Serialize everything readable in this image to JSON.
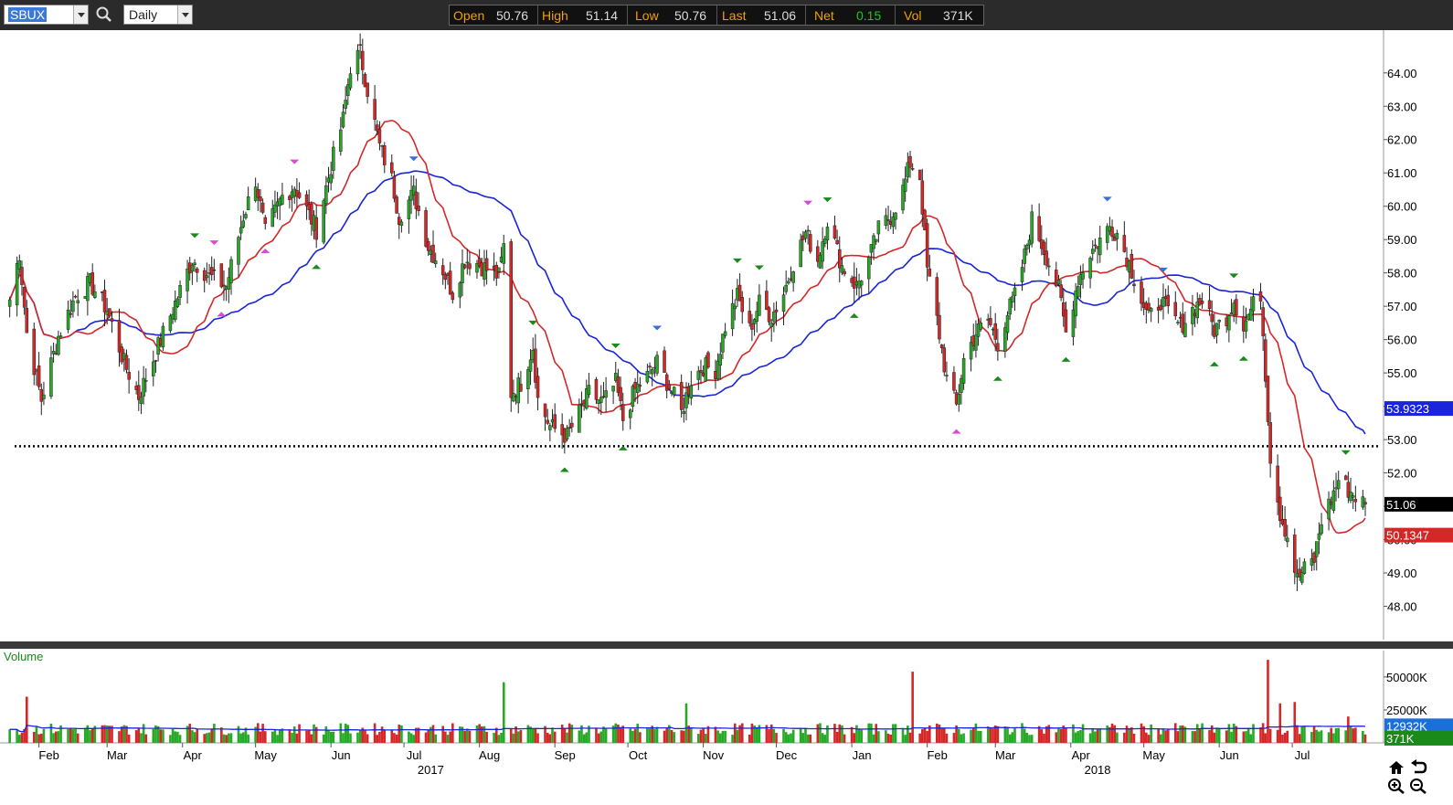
{
  "toolbar": {
    "symbol": "SBUX",
    "interval": "Daily",
    "search_icon": "search-icon",
    "quote": {
      "open_label": "Open",
      "open": "50.76",
      "high_label": "High",
      "high": "51.14",
      "low_label": "Low",
      "low": "50.76",
      "last_label": "Last",
      "last": "51.06",
      "net_label": "Net",
      "net": "0.15",
      "vol_label": "Vol",
      "vol": "371K"
    }
  },
  "colors": {
    "up_candle": "#27a827",
    "down_candle": "#d42828",
    "ma_fast": "#d42828",
    "ma_slow": "#1a24d8",
    "volume_avg": "#1a24d8",
    "marker_green": "#1a8a1a",
    "marker_blue": "#3a6fd8",
    "marker_magenta": "#d84ad8",
    "net_positive": "#22c322"
  },
  "chart_data": [
    {
      "type": "candlestick",
      "symbol": "SBUX",
      "interval": "Daily",
      "ylim": [
        47,
        65.2
      ],
      "price_ticks": [
        "48.00",
        "49.00",
        "50.00",
        "51.00",
        "52.00",
        "53.00",
        "54.00",
        "55.00",
        "56.00",
        "57.00",
        "58.00",
        "59.00",
        "60.00",
        "61.00",
        "62.00",
        "63.00",
        "64.00"
      ],
      "x_months": [
        "Feb",
        "Mar",
        "Apr",
        "May",
        "Jun",
        "Jul",
        "Aug",
        "Sep",
        "Oct",
        "Nov",
        "Dec",
        "Jan",
        "Feb",
        "Mar",
        "Apr",
        "May",
        "Jun",
        "Jul"
      ],
      "x_years": [
        "2017",
        "2018"
      ],
      "price_keypoints": [
        [
          "2017-01-20",
          57.2
        ],
        [
          "2017-01-24",
          58.6
        ],
        [
          "2017-01-27",
          56.2
        ],
        [
          "2017-02-02",
          54.2
        ],
        [
          "2017-02-09",
          56.1
        ],
        [
          "2017-02-16",
          57.3
        ],
        [
          "2017-02-22",
          57.7
        ],
        [
          "2017-03-01",
          56.9
        ],
        [
          "2017-03-08",
          55.3
        ],
        [
          "2017-03-14",
          54.3
        ],
        [
          "2017-03-22",
          55.8
        ],
        [
          "2017-03-29",
          57.1
        ],
        [
          "2017-04-05",
          58.4
        ],
        [
          "2017-04-12",
          57.9
        ],
        [
          "2017-04-19",
          57.6
        ],
        [
          "2017-04-26",
          59.7
        ],
        [
          "2017-05-01",
          60.8
        ],
        [
          "2017-05-05",
          59.2
        ],
        [
          "2017-05-12",
          60.3
        ],
        [
          "2017-05-17",
          60.6
        ],
        [
          "2017-05-22",
          59.9
        ],
        [
          "2017-05-26",
          59.3
        ],
        [
          "2017-06-01",
          61.2
        ],
        [
          "2017-06-06",
          62.6
        ],
        [
          "2017-06-09",
          64.2
        ],
        [
          "2017-06-13",
          64.6
        ],
        [
          "2017-06-16",
          63.5
        ],
        [
          "2017-06-21",
          61.8
        ],
        [
          "2017-06-26",
          60.8
        ],
        [
          "2017-06-29",
          59.7
        ],
        [
          "2017-07-05",
          60.4
        ],
        [
          "2017-07-11",
          58.8
        ],
        [
          "2017-07-17",
          58.1
        ],
        [
          "2017-07-21",
          57.4
        ],
        [
          "2017-07-26",
          58.4
        ],
        [
          "2017-07-31",
          58.3
        ],
        [
          "2017-08-04",
          58.1
        ],
        [
          "2017-08-09",
          57.9
        ],
        [
          "2017-08-11",
          58.8
        ],
        [
          "2017-08-14",
          54.4
        ],
        [
          "2017-08-18",
          54.7
        ],
        [
          "2017-08-23",
          55.8
        ],
        [
          "2017-08-25",
          54.2
        ],
        [
          "2017-08-30",
          53.4
        ],
        [
          "2017-09-06",
          53.1
        ],
        [
          "2017-09-11",
          53.8
        ],
        [
          "2017-09-15",
          54.4
        ],
        [
          "2017-09-21",
          54.1
        ],
        [
          "2017-09-26",
          54.7
        ],
        [
          "2017-09-29",
          53.6
        ],
        [
          "2017-10-04",
          54.5
        ],
        [
          "2017-10-09",
          54.9
        ],
        [
          "2017-10-13",
          55.3
        ],
        [
          "2017-10-18",
          54.6
        ],
        [
          "2017-10-23",
          53.8
        ],
        [
          "2017-10-27",
          54.8
        ],
        [
          "2017-11-01",
          55.2
        ],
        [
          "2017-11-06",
          55.1
        ],
        [
          "2017-11-10",
          56.4
        ],
        [
          "2017-11-15",
          57.3
        ],
        [
          "2017-11-20",
          56.3
        ],
        [
          "2017-11-24",
          57.1
        ],
        [
          "2017-11-29",
          56.7
        ],
        [
          "2017-12-04",
          57.4
        ],
        [
          "2017-12-08",
          58.3
        ],
        [
          "2017-12-13",
          59.2
        ],
        [
          "2017-12-18",
          58.4
        ],
        [
          "2017-12-22",
          59.6
        ],
        [
          "2017-12-28",
          58.2
        ],
        [
          "2018-01-03",
          57.6
        ],
        [
          "2018-01-08",
          58.4
        ],
        [
          "2018-01-12",
          59.3
        ],
        [
          "2018-01-17",
          59.7
        ],
        [
          "2018-01-22",
          60.5
        ],
        [
          "2018-01-25",
          61.3
        ],
        [
          "2018-01-29",
          60.9
        ],
        [
          "2018-02-01",
          58.1
        ],
        [
          "2018-02-05",
          56.6
        ],
        [
          "2018-02-09",
          54.8
        ],
        [
          "2018-02-13",
          54.0
        ],
        [
          "2018-02-16",
          55.4
        ],
        [
          "2018-02-21",
          56.2
        ],
        [
          "2018-02-26",
          56.6
        ],
        [
          "2018-03-02",
          55.9
        ],
        [
          "2018-03-06",
          56.8
        ],
        [
          "2018-03-09",
          57.3
        ],
        [
          "2018-03-13",
          58.5
        ],
        [
          "2018-03-16",
          59.6
        ],
        [
          "2018-03-21",
          58.7
        ],
        [
          "2018-03-27",
          57.5
        ],
        [
          "2018-03-30",
          56.2
        ],
        [
          "2018-04-04",
          57.8
        ],
        [
          "2018-04-09",
          58.6
        ],
        [
          "2018-04-12",
          58.9
        ],
        [
          "2018-04-17",
          59.4
        ],
        [
          "2018-04-20",
          59.2
        ],
        [
          "2018-04-25",
          58.3
        ],
        [
          "2018-04-30",
          57.2
        ],
        [
          "2018-05-03",
          56.6
        ],
        [
          "2018-05-08",
          57.2
        ],
        [
          "2018-05-11",
          56.8
        ],
        [
          "2018-05-16",
          56.4
        ],
        [
          "2018-05-21",
          56.9
        ],
        [
          "2018-05-25",
          57.2
        ],
        [
          "2018-05-30",
          56.3
        ],
        [
          "2018-06-04",
          56.7
        ],
        [
          "2018-06-07",
          57.2
        ],
        [
          "2018-06-11",
          56.4
        ],
        [
          "2018-06-14",
          56.9
        ],
        [
          "2018-06-18",
          57.4
        ],
        [
          "2018-06-20",
          55.0
        ],
        [
          "2018-06-22",
          52.5
        ],
        [
          "2018-06-26",
          50.8
        ],
        [
          "2018-06-29",
          50.1
        ],
        [
          "2018-07-03",
          48.8
        ],
        [
          "2018-07-06",
          49.1
        ],
        [
          "2018-07-10",
          49.4
        ],
        [
          "2018-07-13",
          50.6
        ],
        [
          "2018-07-17",
          51.2
        ],
        [
          "2018-07-20",
          51.8
        ],
        [
          "2018-07-24",
          51.5
        ],
        [
          "2018-07-27",
          51.3
        ],
        [
          "2018-07-31",
          51.06
        ]
      ],
      "moving_averages": [
        {
          "label": "50.1347",
          "value": 50.1347,
          "color": "#d42828"
        },
        {
          "label": "53.9323",
          "value": 53.9323,
          "color": "#1a24d8"
        }
      ],
      "last_price": {
        "label": "51.06",
        "value": 51.06
      },
      "support_line": 52.8
    },
    {
      "type": "bar",
      "title": "Volume",
      "volume_ticks": [
        "25000K",
        "50000K"
      ],
      "ylim": [
        0,
        70000
      ],
      "avg_label": "12932K",
      "last_label": "371K",
      "avg_value": 12932,
      "last_value": 371,
      "volume_keypoints": [
        [
          "2017-01-27",
          35000
        ],
        [
          "2017-08-11",
          46000
        ],
        [
          "2017-10-25",
          30000
        ],
        [
          "2018-01-26",
          54000
        ],
        [
          "2018-06-21",
          63000
        ],
        [
          "2018-06-26",
          30000
        ],
        [
          "2018-07-02",
          31000
        ],
        [
          "2018-07-24",
          20000
        ]
      ]
    }
  ]
}
